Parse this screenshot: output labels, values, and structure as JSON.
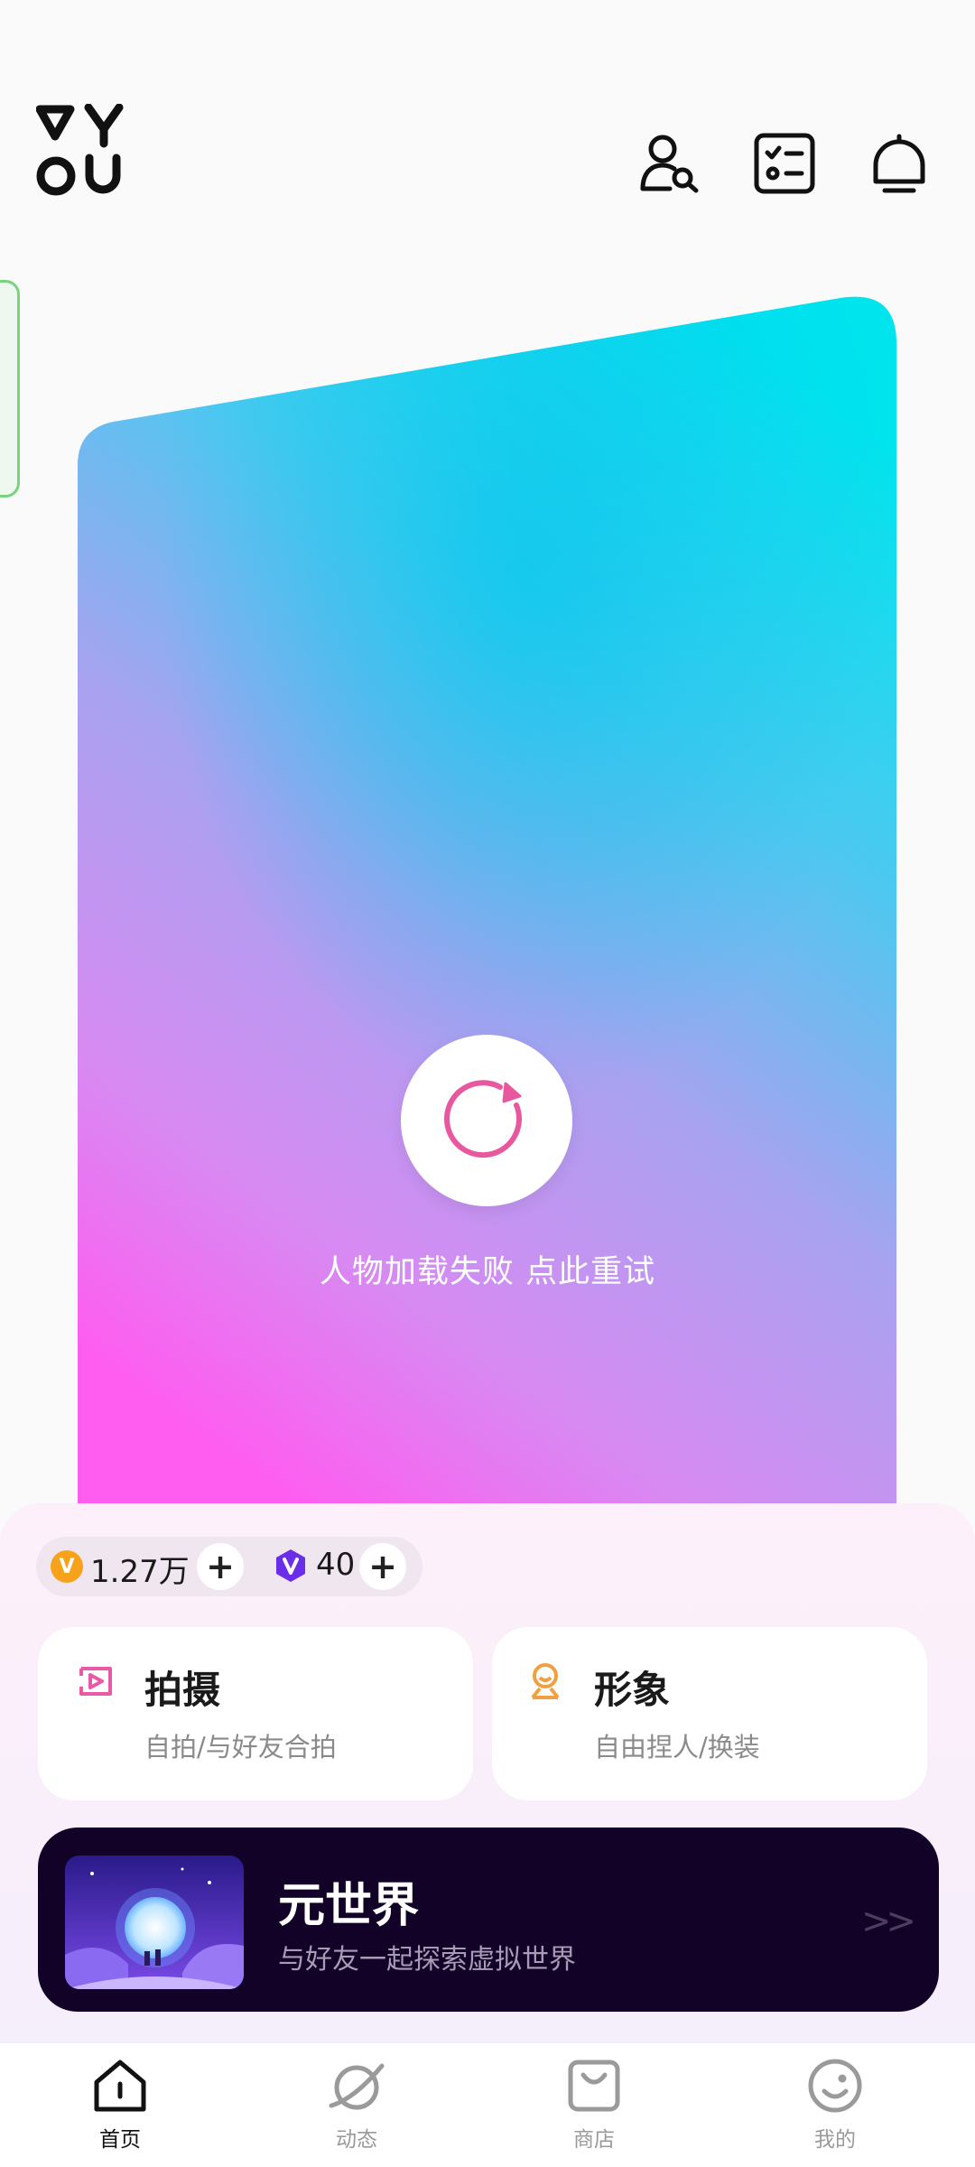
{
  "header": {
    "logo_icon": "vyou-logo",
    "icons": [
      "friend-search-icon",
      "task-list-icon",
      "notification-bell-icon"
    ]
  },
  "hero": {
    "retry_icon": "refresh-icon",
    "retry_text": "人物加载失败 点此重试",
    "gradient_colors": [
      "#00e0ec",
      "#a8a2f0",
      "#ff5cf0"
    ]
  },
  "currency": {
    "coins": {
      "icon": "v-coin-icon",
      "value": "1.27万",
      "color": "#f7a21b"
    },
    "gems": {
      "icon": "v-gem-icon",
      "value": "40",
      "color": "#6a2ee8"
    },
    "plus_label": "+"
  },
  "features": [
    {
      "icon": "camera-play-icon",
      "title": "拍摄",
      "subtitle": "自拍/与好友合拍",
      "color": "#e85aa8"
    },
    {
      "icon": "avatar-icon",
      "title": "形象",
      "subtitle": "自由捏人/换装",
      "color": "#f0a040"
    }
  ],
  "meta_world": {
    "title": "元世界",
    "subtitle": "与好友一起探索虚拟世界",
    "arrow": ">>"
  },
  "nav": {
    "items": [
      {
        "label": "首页",
        "icon": "home-icon",
        "active": true
      },
      {
        "label": "动态",
        "icon": "planet-icon",
        "active": false
      },
      {
        "label": "商店",
        "icon": "shopping-bag-icon",
        "active": false
      },
      {
        "label": "我的",
        "icon": "smiley-profile-icon",
        "active": false
      }
    ]
  }
}
